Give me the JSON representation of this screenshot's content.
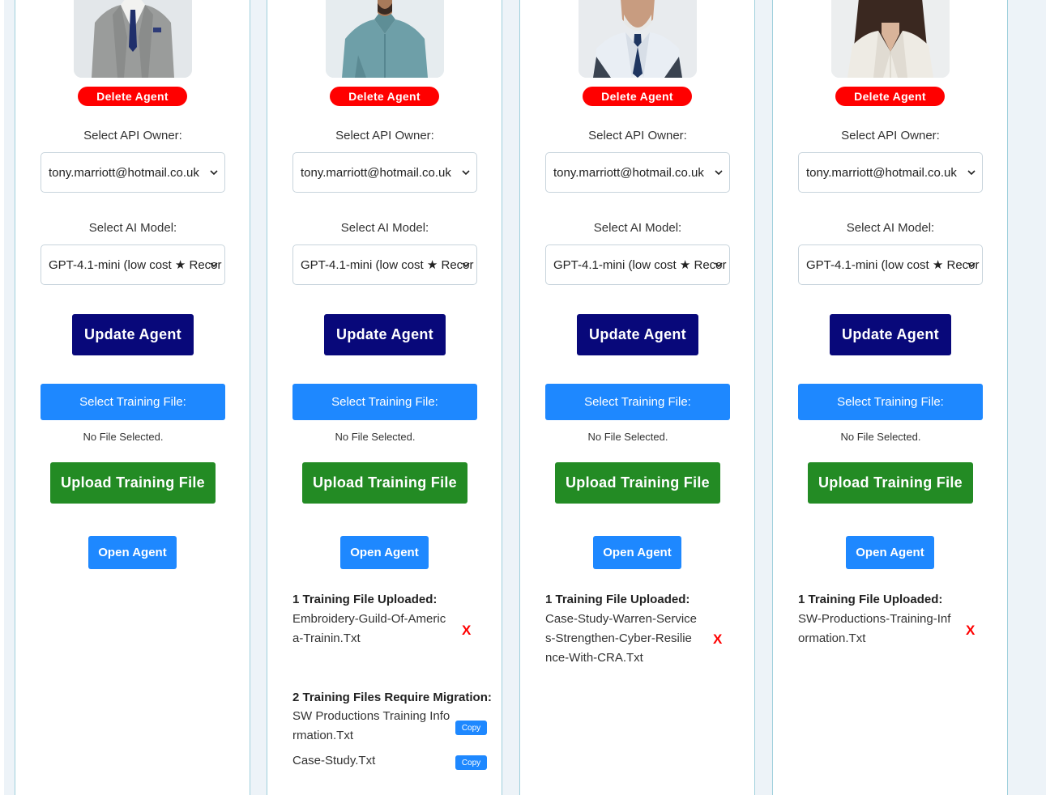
{
  "agents": [
    {
      "photo": "man-grey-suit-photo",
      "delete_label": "Delete Agent",
      "api_owner_label": "Select API Owner:",
      "api_owner_value": "tony.marriott@hotmail.co.uk",
      "model_label": "Select AI Model:",
      "model_value": "GPT-4.1-mini (low cost ★ Recor",
      "update_label": "Update Agent",
      "select_file_label": "Select Training File:",
      "no_file_text": "No File Selected.",
      "upload_label": "Upload Training File",
      "open_label": "Open Agent"
    },
    {
      "photo": "man-denim-shirt-photo",
      "delete_label": "Delete Agent",
      "api_owner_label": "Select API Owner:",
      "api_owner_value": "tony.marriott@hotmail.co.uk",
      "model_label": "Select AI Model:",
      "model_value": "GPT-4.1-mini (low cost ★ Recor",
      "update_label": "Update Agent",
      "select_file_label": "Select Training File:",
      "no_file_text": "No File Selected.",
      "upload_label": "Upload Training File",
      "open_label": "Open Agent",
      "uploaded_title": "1 Training File Uploaded:",
      "uploaded_file": "Embroidery-Guild-Of-America-Trainin.Txt",
      "remove_label": "X",
      "migration_title": "2 Training Files Require Migration:",
      "migration_files": [
        "SW Productions Training Information.Txt",
        "Case-Study.Txt"
      ],
      "copy_label": "Copy"
    },
    {
      "photo": "older-man-tie-photo",
      "delete_label": "Delete Agent",
      "api_owner_label": "Select API Owner:",
      "api_owner_value": "tony.marriott@hotmail.co.uk",
      "model_label": "Select AI Model:",
      "model_value": "GPT-4.1-mini (low cost ★ Recor",
      "update_label": "Update Agent",
      "select_file_label": "Select Training File:",
      "no_file_text": "No File Selected.",
      "upload_label": "Upload Training File",
      "open_label": "Open Agent",
      "uploaded_title": "1 Training File Uploaded:",
      "uploaded_file": "Case-Study-Warren-Services-Strengthen-Cyber-Resilience-With-CRA.Txt",
      "remove_label": "X"
    },
    {
      "photo": "woman-white-blazer-photo",
      "delete_label": "Delete Agent",
      "api_owner_label": "Select API Owner:",
      "api_owner_value": "tony.marriott@hotmail.co.uk",
      "model_label": "Select AI Model:",
      "model_value": "GPT-4.1-mini (low cost ★ Recor",
      "update_label": "Update Agent",
      "select_file_label": "Select Training File:",
      "no_file_text": "No File Selected.",
      "upload_label": "Upload Training File",
      "open_label": "Open Agent",
      "uploaded_title": "1 Training File Uploaded:",
      "uploaded_file": "SW-Productions-Training-Information.Txt",
      "remove_label": "X"
    }
  ],
  "colors": {
    "delete": "#ff0000",
    "update": "#08087a",
    "primary": "#1e88ff",
    "upload": "#238b24",
    "card_border": "#9fd0dc",
    "background": "#edf3f8"
  }
}
